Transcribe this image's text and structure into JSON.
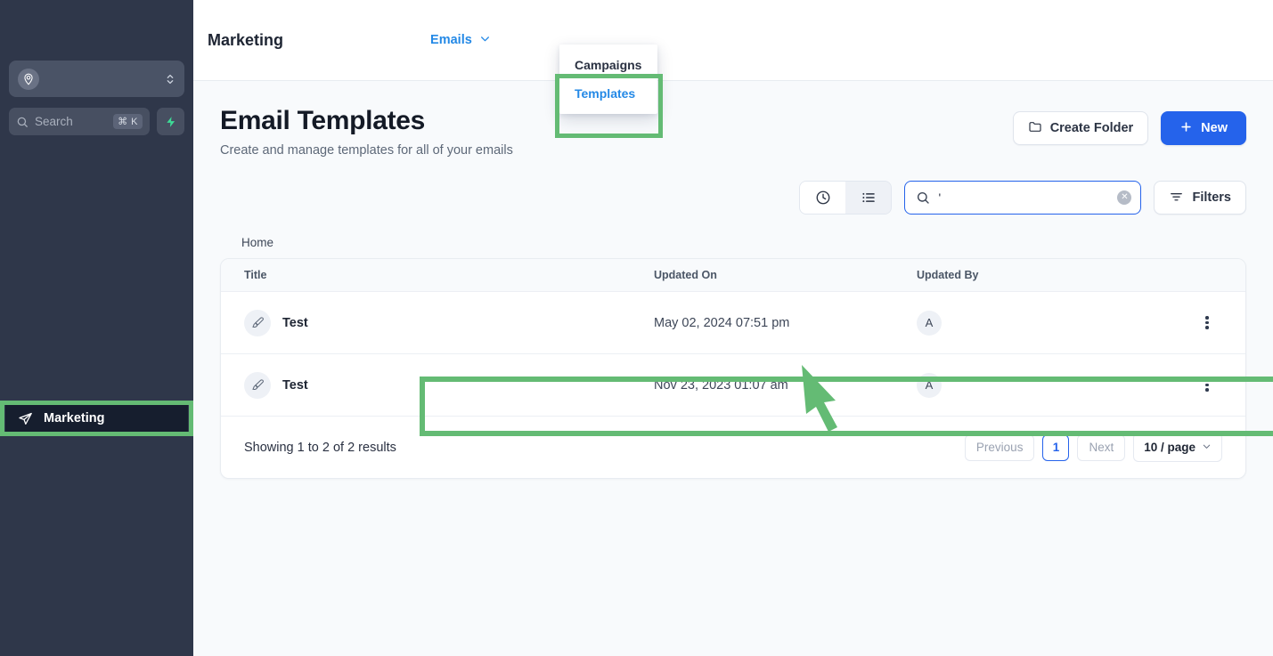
{
  "sidebar": {
    "workspace": {
      "icon": "workspace-pin-icon",
      "chevrons_icon": "chevron-up-down-icon"
    },
    "search": {
      "placeholder": "Search",
      "shortcut": "⌘ K",
      "icon": "search-icon"
    },
    "spark_button": {
      "icon": "lightning-icon"
    },
    "nav_items": [
      {
        "label": "Marketing",
        "icon": "paper-plane-icon",
        "active": true
      }
    ]
  },
  "topbar": {
    "title": "Marketing",
    "switcher": {
      "label": "Emails",
      "icon": "chevron-down-icon"
    },
    "dropdown": {
      "items": [
        {
          "label": "Campaigns",
          "active": false
        },
        {
          "label": "Templates",
          "active": true
        }
      ]
    }
  },
  "page": {
    "title": "Email Templates",
    "subtitle": "Create and manage templates for all of your emails",
    "create_folder_label": "Create Folder",
    "new_label": "New",
    "create_folder_icon": "folder-icon",
    "new_icon": "plus-icon"
  },
  "toolbar": {
    "recent_view_icon": "clock-icon",
    "list_view_icon": "list-icon",
    "search": {
      "value": "'",
      "icon": "search-icon",
      "clear_icon": "clear-circle-icon"
    },
    "filters_label": "Filters",
    "filters_icon": "filter-icon"
  },
  "breadcrumb": {
    "label": "Home"
  },
  "table": {
    "columns": [
      "Title",
      "Updated On",
      "Updated By"
    ],
    "rows": [
      {
        "title": "Test",
        "updated_on": "May 02, 2024 07:51 pm",
        "updated_by": "A",
        "icon": "paintbrush-icon",
        "menu_icon": "kebab-menu-icon"
      },
      {
        "title": "Test",
        "updated_on": "Nov 23, 2023 01:07 am",
        "updated_by": "A",
        "icon": "paintbrush-icon",
        "menu_icon": "kebab-menu-icon"
      }
    ]
  },
  "footer": {
    "results_text": "Showing 1 to 2 of 2 results",
    "previous_label": "Previous",
    "page_label": "1",
    "next_label": "Next",
    "page_size_label": "10 / page",
    "page_size_icon": "chevron-down-icon"
  },
  "annotations": {
    "highlight_color": "#64bb74",
    "cursor_icon": "arrow-cursor"
  }
}
